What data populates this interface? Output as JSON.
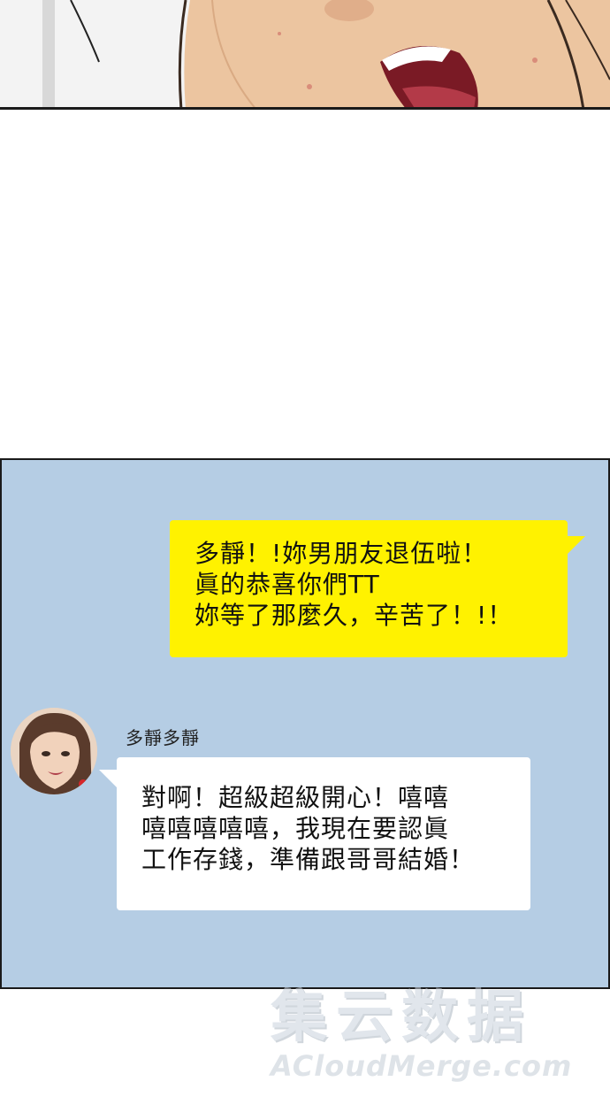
{
  "outgoing_message": {
    "line1": "多靜！!妳男朋友退伍啦！",
    "line2": "眞的恭喜你們TT",
    "line3": "妳等了那麼久，辛苦了！!！"
  },
  "incoming_message": {
    "sender": "多靜多靜",
    "line1": "對啊！超級超級開心！嘻嘻",
    "line2": "嘻嘻嘻嘻嘻，我現在要認眞",
    "line3": "工作存錢，準備跟哥哥結婚！"
  },
  "watermark": {
    "cn": "集云数据",
    "en": "ACloudMerge.com"
  },
  "colors": {
    "chat_background": "#b5cde4",
    "outgoing_bubble": "#fff200",
    "incoming_bubble": "#ffffff"
  }
}
